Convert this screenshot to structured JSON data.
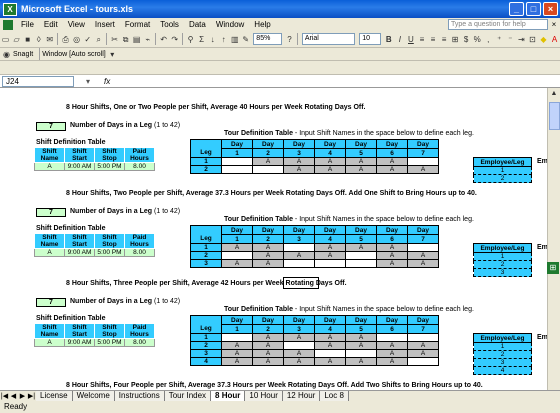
{
  "window": {
    "title": "Microsoft Excel - tours.xls"
  },
  "menu": {
    "items": [
      "File",
      "Edit",
      "View",
      "Insert",
      "Format",
      "Tools",
      "Data",
      "Window",
      "Help"
    ],
    "ask_placeholder": "Type a question for help"
  },
  "toolbar": {
    "zoom": "85%",
    "font": "Arial",
    "size": "10"
  },
  "toolbar2": {
    "snagit": "SnagIt",
    "window": "Window",
    "scroll": "[Auto scroll]"
  },
  "formula": {
    "namebox": "J24",
    "fx": "fx"
  },
  "sheet": {
    "sections": [
      {
        "heading": "8 Hour Shifts, One or Two People per Shift, Average 40 Hours per Week Rotating Days Off.",
        "count": "7",
        "legs_rows": [
          [
            "1",
            "",
            "A",
            "A",
            "A",
            "A",
            "A",
            ""
          ],
          [
            "2",
            "",
            "",
            "A",
            "A",
            "A",
            "A",
            "A"
          ]
        ]
      },
      {
        "heading": "8 Hour Shifts, Two People per Shift, Average 37.3 Hours per Week Rotating Days Off.  Add One Shift to Bring Hours up to 40.",
        "count": "7",
        "legs_rows": [
          [
            "1",
            "A",
            "A",
            "",
            "A",
            "A",
            "A",
            ""
          ],
          [
            "2",
            "",
            "A",
            "A",
            "A",
            "",
            "A",
            "A"
          ],
          [
            "3",
            "A",
            "A",
            "",
            "",
            "",
            "A",
            "A"
          ]
        ]
      },
      {
        "heading": "8 Hour Shifts, Three People per Shift, Average 42 Hours per Week Rotating Days Off.",
        "count": "7",
        "legs_rows": [
          [
            "1",
            "",
            "A",
            "A",
            "A",
            "A",
            "",
            ""
          ],
          [
            "2",
            "A",
            "A",
            "",
            "A",
            "A",
            "A",
            "A"
          ],
          [
            "3",
            "A",
            "A",
            "A",
            "",
            "",
            "A",
            "A"
          ],
          [
            "4",
            "A",
            "A",
            "A",
            "A",
            "A",
            "A",
            ""
          ]
        ]
      }
    ],
    "heading4": "8 Hour Shifts, Four People per Shift, Average 37.3 Hours per Week Rotating Days Off.  Add Two Shifts to Bring Hours up to 40.",
    "count_label": "Number of Days in a Leg",
    "count_range": "(1 to 42)",
    "shift_def_title": "Shift Definition Table",
    "shift_headers": [
      "Shift\nName",
      "Shift\nStart",
      "Shift\nStop",
      "Paid\nHours"
    ],
    "shift_row": [
      "A",
      "9:00 AM",
      "5:00 PM",
      "8.00"
    ],
    "tour_title_bold": "Tour Definition Table",
    "tour_title_rest": " - Input Shift Names in the space below to define each leg.",
    "leg_header": "Leg",
    "day_header": "Day",
    "day_numbers": [
      "1",
      "2",
      "3",
      "4",
      "5",
      "6",
      "7"
    ],
    "employee_header": "Employee/Leg",
    "em_cut": "Em"
  },
  "tabs": [
    "License",
    "Welcome",
    "Instructions",
    "Tour Index",
    "8 Hour",
    "10 Hour",
    "12 Hour",
    "Loc 8"
  ],
  "active_tab": "8 Hour",
  "status": "Ready"
}
